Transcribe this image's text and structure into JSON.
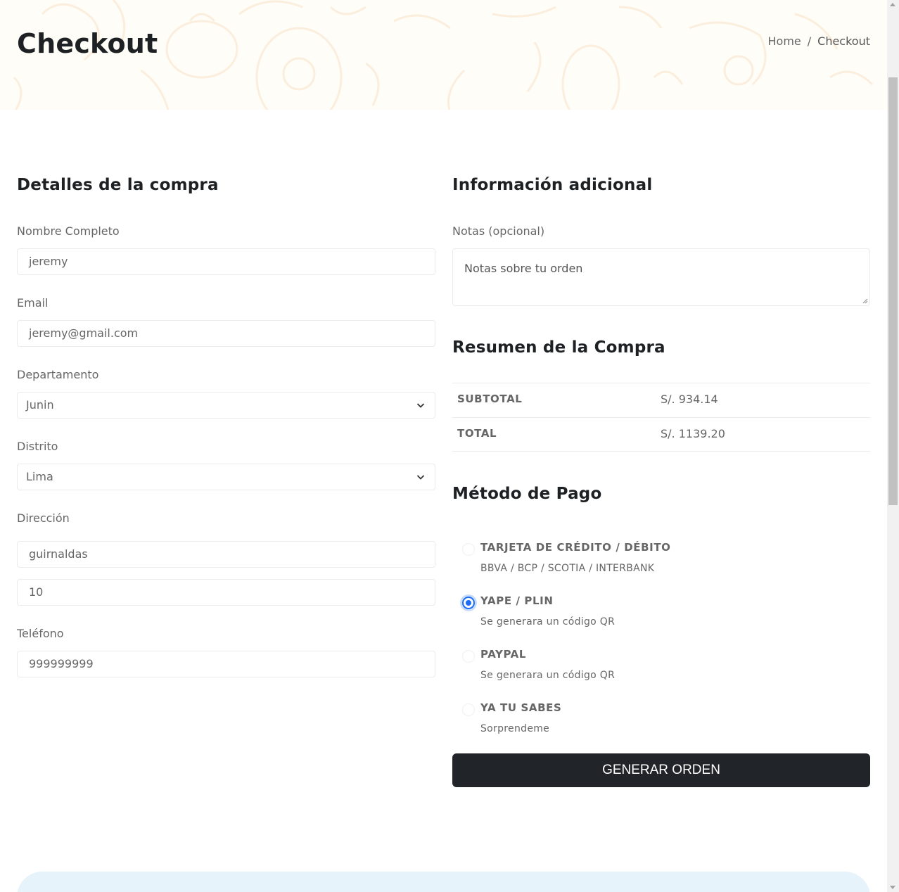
{
  "header": {
    "title": "Checkout",
    "breadcrumb": {
      "home": "Home",
      "separator": "/",
      "current": "Checkout"
    }
  },
  "billing": {
    "heading": "Detalles de la compra",
    "name_label": "Nombre Completo",
    "name_value": "jeremy",
    "email_label": "Email",
    "email_value": "jeremy@gmail.com",
    "department_label": "Departamento",
    "department_value": "Junin",
    "district_label": "Distrito",
    "district_value": "Lima",
    "address_label": "Dirección",
    "address_line1": "guirnaldas",
    "address_line2": "10",
    "phone_label": "Teléfono",
    "phone_value": "999999999"
  },
  "additional": {
    "heading": "Información adicional",
    "notes_label": "Notas (opcional)",
    "notes_placeholder": "Notas sobre tu orden"
  },
  "summary": {
    "heading": "Resumen de la Compra",
    "rows": [
      {
        "label": "SUBTOTAL",
        "value": "S/. 934.14"
      },
      {
        "label": "TOTAL",
        "value": "S/. 1139.20"
      }
    ]
  },
  "payment": {
    "heading": "Método de Pago",
    "selected_index": 1,
    "options": [
      {
        "title": "TARJETA DE CRÉDITO / DÉBITO",
        "subtitle": "BBVA / BCP / SCOTIA / INTERBANK"
      },
      {
        "title": "YAPE / PLIN",
        "subtitle": "Se generara un código QR"
      },
      {
        "title": "PAYPAL",
        "subtitle": "Se generara un código QR"
      },
      {
        "title": "YA TU SABES",
        "subtitle": "Sorprendeme"
      }
    ],
    "submit_label": "GENERAR ORDEN"
  },
  "colors": {
    "hero_bg": "#fffdf8",
    "button_bg": "#212529",
    "radio_accent": "#1b6ef3",
    "banner_bg": "#e6f3fb"
  }
}
